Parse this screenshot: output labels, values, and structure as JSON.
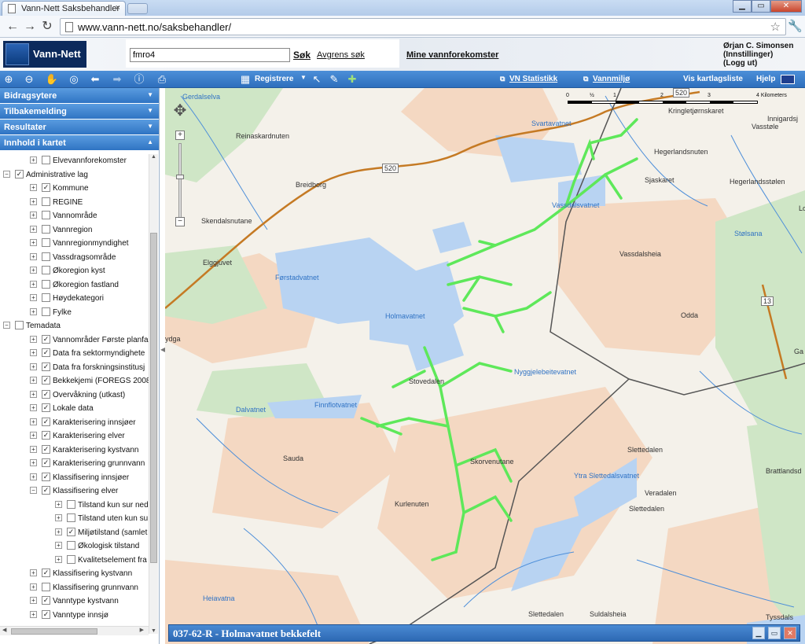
{
  "browser": {
    "tab_title": "Vann-Nett Saksbehandler",
    "tab_close": "×",
    "url": "www.vann-nett.no/saksbehandler/",
    "win_min": "▁",
    "win_max": "▭",
    "win_close": "✕"
  },
  "app": {
    "logo": "Vann-Nett",
    "search_value": "fmro4",
    "search_button": "Søk",
    "refine_link": "Avgrens søk",
    "my_waters_link": "Mine vannforekomster",
    "user_name": "Ørjan C. Simonsen",
    "settings_link": "(Innstillinger)",
    "logout_link": "(Logg ut)"
  },
  "toolbar": {
    "register_label": "Registrere",
    "stats_link": "VN Statistikk",
    "env_link": "Vannmiljø",
    "layer_list_link": "Vis kartlagsliste",
    "help_link": "Hjelp"
  },
  "sidebar": {
    "sections": [
      {
        "label": "Bidragsytere",
        "arrow": "▼"
      },
      {
        "label": "Tilbakemelding",
        "arrow": "▼"
      },
      {
        "label": "Resultater",
        "arrow": "▼"
      },
      {
        "label": "Innhold i kartet",
        "arrow": "▲"
      }
    ],
    "tree": [
      {
        "label": "Elvevannforekomster",
        "level": 2,
        "exp": "+",
        "checked": false
      },
      {
        "label": "Administrative lag",
        "level": 1,
        "exp": "−",
        "checked": true
      },
      {
        "label": "Kommune",
        "level": 2,
        "exp": "+",
        "checked": true
      },
      {
        "label": "REGINE",
        "level": 2,
        "exp": "+",
        "checked": false
      },
      {
        "label": "Vannområde",
        "level": 2,
        "exp": "+",
        "checked": false
      },
      {
        "label": "Vannregion",
        "level": 2,
        "exp": "+",
        "checked": false
      },
      {
        "label": "Vannregionmyndighet",
        "level": 2,
        "exp": "+",
        "checked": false
      },
      {
        "label": "Vassdragsområde",
        "level": 2,
        "exp": "+",
        "checked": false
      },
      {
        "label": "Økoregion kyst",
        "level": 2,
        "exp": "+",
        "checked": false
      },
      {
        "label": "Økoregion fastland",
        "level": 2,
        "exp": "+",
        "checked": false
      },
      {
        "label": "Høydekategori",
        "level": 2,
        "exp": "+",
        "checked": false
      },
      {
        "label": "Fylke",
        "level": 2,
        "exp": "+",
        "checked": false
      },
      {
        "label": "Temadata",
        "level": 1,
        "exp": "−",
        "checked": false
      },
      {
        "label": "Vannområder Første planfa",
        "level": 2,
        "exp": "+",
        "checked": true
      },
      {
        "label": "Data fra sektormyndighete",
        "level": 2,
        "exp": "+",
        "checked": true
      },
      {
        "label": "Data fra forskningsinstitusj",
        "level": 2,
        "exp": "+",
        "checked": true
      },
      {
        "label": "Bekkekjemi (FOREGS 2008",
        "level": 2,
        "exp": "+",
        "checked": true
      },
      {
        "label": "Overvåkning (utkast)",
        "level": 2,
        "exp": "+",
        "checked": true
      },
      {
        "label": "Lokale data",
        "level": 2,
        "exp": "+",
        "checked": true
      },
      {
        "label": "Karakterisering innsjøer",
        "level": 2,
        "exp": "+",
        "checked": true
      },
      {
        "label": "Karakterisering elver",
        "level": 2,
        "exp": "+",
        "checked": true
      },
      {
        "label": "Karakterisering kystvann",
        "level": 2,
        "exp": "+",
        "checked": true
      },
      {
        "label": "Karakterisering grunnvann",
        "level": 2,
        "exp": "+",
        "checked": true
      },
      {
        "label": "Klassifisering innsjøer",
        "level": 2,
        "exp": "+",
        "checked": true
      },
      {
        "label": "Klassifisering elver",
        "level": 2,
        "exp": "−",
        "checked": true
      },
      {
        "label": "Tilstand kun sur ned",
        "level": 3,
        "exp": "+",
        "checked": false
      },
      {
        "label": "Tilstand uten kun su",
        "level": 3,
        "exp": "+",
        "checked": false
      },
      {
        "label": "Miljøtilstand (samlet",
        "level": 3,
        "exp": "+",
        "checked": true
      },
      {
        "label": "Økologisk tilstand",
        "level": 3,
        "exp": "+",
        "checked": false
      },
      {
        "label": "Kvalitetselement fra",
        "level": 3,
        "exp": "+",
        "checked": false
      },
      {
        "label": "Klassifisering kystvann",
        "level": 2,
        "exp": "+",
        "checked": true
      },
      {
        "label": "Klassifisering grunnvann",
        "level": 2,
        "exp": "+",
        "checked": false
      },
      {
        "label": "Vanntype kystvann",
        "level": 2,
        "exp": "+",
        "checked": true
      },
      {
        "label": "Vanntype innsjø",
        "level": 2,
        "exp": "+",
        "checked": true
      }
    ]
  },
  "map": {
    "scale_ticks": [
      "0",
      "½",
      "1",
      "2",
      "3",
      "4 Kilometers"
    ],
    "road_shields": [
      "520",
      "520",
      "13"
    ],
    "labels": [
      {
        "text": "Reinaskardnuten",
        "water": false
      },
      {
        "text": "Svartavatnet",
        "water": true
      },
      {
        "text": "Kringletjørnskaret",
        "water": false
      },
      {
        "text": "Vasstøle",
        "water": false
      },
      {
        "text": "Innigardsj",
        "water": false
      },
      {
        "text": "Hegerlandsnuten",
        "water": false
      },
      {
        "text": "Hegerlandsstølen",
        "water": false
      },
      {
        "text": "Breidborg",
        "water": false
      },
      {
        "text": "Sjaskaret",
        "water": false
      },
      {
        "text": "Vassdalsvatnet",
        "water": true
      },
      {
        "text": "Stølsana",
        "water": true
      },
      {
        "text": "Vassdalsheia",
        "water": false
      },
      {
        "text": "Skendalsnutane",
        "water": false
      },
      {
        "text": "Elggjuvet",
        "water": false
      },
      {
        "text": "Førstadvatnet",
        "water": true
      },
      {
        "text": "Holmavatnet",
        "water": true
      },
      {
        "text": "Odda",
        "water": false
      },
      {
        "text": "Nyggjelebeitevatnet",
        "water": true
      },
      {
        "text": "Stovedalen",
        "water": false
      },
      {
        "text": "Dalvatnet",
        "water": true
      },
      {
        "text": "Finnflotvatnet",
        "water": true
      },
      {
        "text": "Sauda",
        "water": false
      },
      {
        "text": "Skorvenutane",
        "water": false
      },
      {
        "text": "Slettedalen",
        "water": false
      },
      {
        "text": "Brattlandsd",
        "water": false
      },
      {
        "text": "Ytra Slettedalsvatnet",
        "water": true
      },
      {
        "text": "Veradalen",
        "water": false
      },
      {
        "text": "Kurlenuten",
        "water": false
      },
      {
        "text": "Slettedalen",
        "water": false
      },
      {
        "text": "Heiavatna",
        "water": true
      },
      {
        "text": "Slettedalen",
        "water": false
      },
      {
        "text": "Suldalsheia",
        "water": false
      },
      {
        "text": "Tyssdals",
        "water": false
      },
      {
        "text": "Gerdalselva",
        "water": true
      },
      {
        "text": "ydga",
        "water": false
      },
      {
        "text": "Ga",
        "water": false
      },
      {
        "text": "Lo",
        "water": false
      }
    ],
    "zoom_in": "+",
    "zoom_out": "−"
  },
  "status": {
    "feature_title": "037-62-R - Holmavatnet bekkefelt"
  },
  "colors": {
    "highlight": "#5ee85a",
    "water": "#b8d3f2",
    "terrain": "#f4d8c2",
    "forest": "#cfe6c6",
    "toolbar": "#2e6fbd"
  }
}
